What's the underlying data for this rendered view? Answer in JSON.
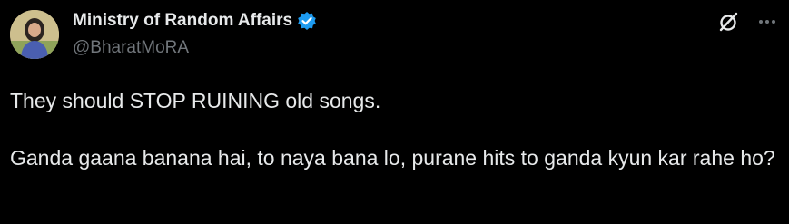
{
  "author": {
    "display_name": "Ministry of Random Affairs",
    "handle": "@BharatMoRA",
    "verified": true
  },
  "icons": {
    "verified": "verified-badge-icon",
    "grok": "grok-icon",
    "more": "more-options-icon"
  },
  "tweet": {
    "paragraphs": [
      "They should STOP RUINING old songs.",
      "Ganda gaana banana hai, to naya bana lo, purane hits to ganda kyun kar rahe ho?"
    ]
  },
  "colors": {
    "background": "#000000",
    "primary_text": "#e7e9ea",
    "secondary_text": "#71767b",
    "verified_blue": "#1d9bf0"
  }
}
